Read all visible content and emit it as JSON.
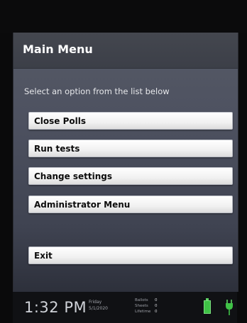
{
  "window": {
    "title": "Main Menu"
  },
  "instruction": "Select an option from the list below",
  "menu": {
    "items": [
      {
        "label": "Close Polls"
      },
      {
        "label": "Run tests"
      },
      {
        "label": "Change settings"
      },
      {
        "label": "Administrator Menu"
      }
    ],
    "exit_label": "Exit"
  },
  "status_bar": {
    "time": "1:32 PM",
    "day": "Friday",
    "date": "5/1/2020",
    "counters": [
      {
        "label": "Ballots",
        "value": "0"
      },
      {
        "label": "Sheets",
        "value": "0"
      },
      {
        "label": "Lifetime",
        "value": "0"
      }
    ],
    "icons": [
      "battery-icon",
      "power-plug-icon"
    ],
    "battery_color": "#3fc246"
  }
}
